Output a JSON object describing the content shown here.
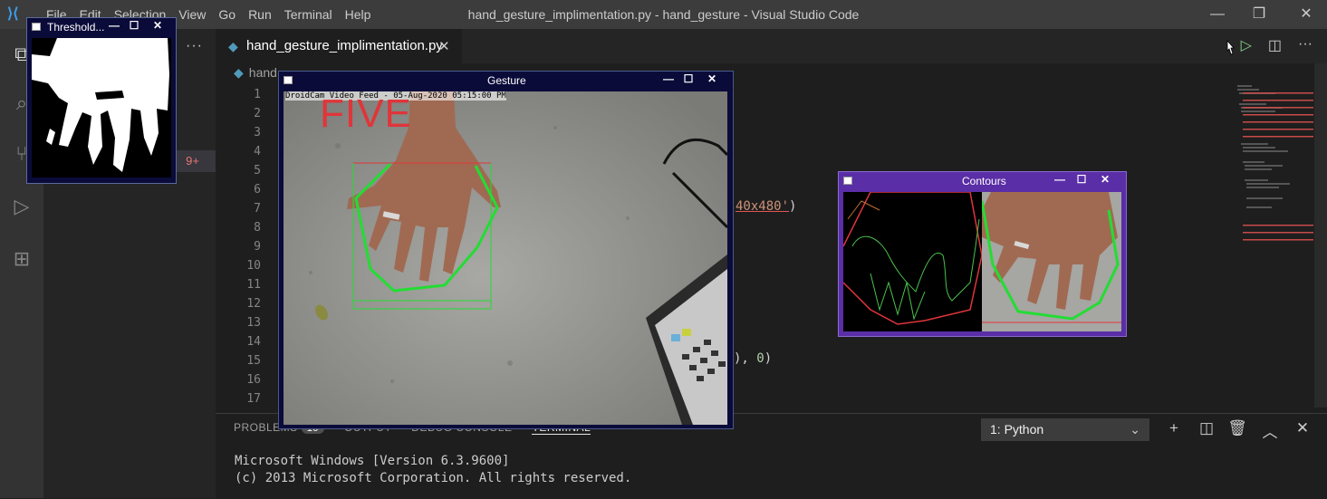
{
  "app": {
    "logo": "vscode-logo",
    "menu": [
      "File",
      "Edit",
      "Selection",
      "View",
      "Go",
      "Run",
      "Terminal",
      "Help"
    ],
    "title": "hand_gesture_implimentation.py - hand_gesture - Visual Studio Code"
  },
  "window_controls": [
    "minimize-icon",
    "restore-icon",
    "close-icon"
  ],
  "activity_bar": [
    "explorer-icon",
    "search-icon",
    "source-control-icon",
    "run-debug-icon",
    "extensions-icon"
  ],
  "sidebar": {
    "more": "···",
    "badge": "9+"
  },
  "editor": {
    "tab_label": "hand_gesture_implimentation.py",
    "breadcrumb": "hand",
    "line_numbers": [
      "1",
      "2",
      "3",
      "4",
      "5",
      "6",
      "7",
      "8",
      "9",
      "10",
      "11",
      "12",
      "13",
      "14",
      "15",
      "16",
      "17"
    ],
    "code_line7_fragment": "40x480'",
    "code_line7_tail": ")",
    "code_line15_fragment": "), ",
    "code_line15_num": "0",
    "code_line15_tail": ")"
  },
  "panel": {
    "tabs": [
      "PROBLEMS",
      "OUTPUT",
      "DEBUG CONSOLE",
      "TERMINAL"
    ],
    "problems_count": "10",
    "active_tab": "TERMINAL",
    "terminal_selector": "1: Python",
    "terminal_lines": [
      "Microsoft Windows [Version 6.3.9600]",
      "(c) 2013 Microsoft Corporation. All rights reserved."
    ]
  },
  "windows": {
    "threshold": {
      "title": "Threshold..."
    },
    "gesture": {
      "title": "Gesture",
      "camera_overlay": "DroidCam Video Feed - 05-Aug-2020 05:15:00 PM",
      "detected_label": "FIVE"
    },
    "contours": {
      "title": "Contours"
    }
  },
  "colors": {
    "accent": "#007acc",
    "gesture_frame": "#0b0b3a",
    "contours_frame": "#5a2ea6",
    "threshold_frame": "#0b0b3a",
    "hull_green": "#22dd33",
    "box_red": "#e0353a"
  }
}
